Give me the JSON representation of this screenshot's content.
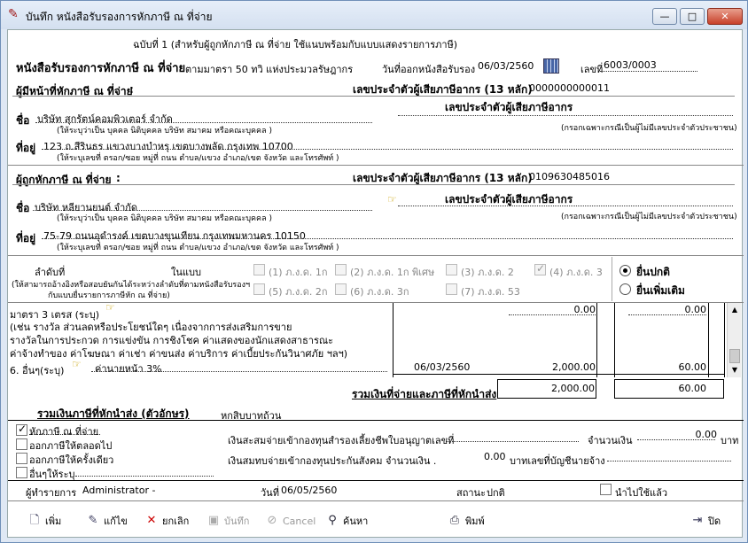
{
  "window": {
    "title": "บันทึก หนังสือรับรองการหักภาษี ณ ที่จ่าย",
    "min": "—",
    "max": "□",
    "close": "✕"
  },
  "header": {
    "copy_note": "ฉบับที่ 1 (สำหรับผู้ถูกหักภาษี ณ ที่จ่าย ใช้แนบพร้อมกับแบบแสดงรายการภาษี)",
    "form_title": "หนังสือรับรองการหักภาษี ณ ที่จ่าย",
    "law_ref": "ตามมาตรา 50 ทวิ แห่งประมวลรัษฎากร",
    "issue_date_label": "วันที่ออกหนังสือรับรอง",
    "issue_date": "06/03/2560",
    "number_label": "เลขที่",
    "number": "6003/0003"
  },
  "payer": {
    "section_label": "ผู้มีหน้าที่หักภาษี ณ ที่จ่าย",
    "colon": ":",
    "tax_id_label": "เลขประจำตัวผู้เสียภาษีอากร (13 หลัก)",
    "tax_id": "0000000000011",
    "tax_id2_label": "เลขประจำตัวผู้เสียภาษีอากร",
    "name_label": "ชื่อ",
    "name": "บริษัท สุกรัตน์คอมพิวเตอร์ จำกัด",
    "name_hint": "(ให้ระบุว่าเป็น บุคคล นิติบุคคล บริษัท สมาคม หรือคณะบุคคล )",
    "name_hint2": "(กรอกเฉพาะกรณีเป็นผู้ไม่มีเลขประจำตัวประชาชน)",
    "addr_label": "ที่อยู่",
    "address": "123 ถ.สีรินธร แขวงบางบำหรุ เขตบางพลัด กรุงเทพ 10700",
    "addr_hint": "(ให้ระบุเลขที่ ตรอก/ซอย หมู่ที่ ถนน ตำบล/แขวง อำเภอ/เขต จังหวัด และโทรศัพท์ )"
  },
  "payee": {
    "section_label": "ผู้ถูกหักภาษี ณ ที่จ่าย",
    "colon": ":",
    "tax_id_label": "เลขประจำตัวผู้เสียภาษีอากร (13 หลัก)",
    "tax_id": "0109630485016",
    "tax_id2_label": "เลขประจำตัวผู้เสียภาษีอากร",
    "name_label": "ชื่อ",
    "name": "บริษัท หลียานยนต์ จำกัด",
    "name_hint": "(ให้ระบุว่าเป็น บุคคล นิติบุคคล บริษัท สมาคม หรือคณะบุคคล )",
    "name_hint2": "(กรอกเฉพาะกรณีเป็นผู้ไม่มีเลขประจำตัวประชาชน)",
    "addr_label": "ที่อยู่",
    "address": "75-79 ถนนอุดำรงค์ เขตบางขุนเทียน กรุงเทพมหานคร 10150",
    "addr_hint": "(ให้ระบุเลขที่ ตรอก/ซอย หมู่ที่ ถนน ตำบล/แขวง อำเภอ/เขต จังหวัด และโทรศัพท์ )"
  },
  "attach": {
    "seq_label": "ลำดับที่",
    "seq_hint1": "(ให้สามารถอ้างอิงหรือสอบยันกันได้ระหว่างลำดับที่ตามหนังสือรับรองฯ",
    "seq_hint2": "กับแบบยื่นรายการภาษีหัก ณ ที่จ่าย)",
    "in_form_label": "ในแบบ",
    "forms": [
      {
        "label": "(1) ภ.ง.ด. 1ก",
        "checked": false
      },
      {
        "label": "(2) ภ.ง.ด. 1ก พิเศษ",
        "checked": false
      },
      {
        "label": "(3) ภ.ง.ด. 2",
        "checked": false
      },
      {
        "label": "(4) ภ.ง.ด. 3",
        "checked": true
      },
      {
        "label": "(5) ภ.ง.ด. 2ก",
        "checked": false
      },
      {
        "label": "(6) ภ.ง.ด. 3ก",
        "checked": false
      },
      {
        "label": "(7) ภ.ง.ด. 53",
        "checked": false
      }
    ],
    "filing": [
      {
        "label": "ยื่นปกติ",
        "selected": true
      },
      {
        "label": "ยื่นเพิ่มเติม",
        "selected": false
      }
    ]
  },
  "income": {
    "row5_lines": [
      "มาตรา 3 เตรส (ระบุ)",
      "(เช่น รางวัล ส่วนลดหรือประโยชน์ใดๆ เนื่องจากการส่งเสริมการขาย",
      "รางวัลในการประกวด การแข่งขัน การชิงโชค ค่าแสดงของนักแสดงสาธารณะ",
      "ค่าจ้างทำของ ค่าโฆษณา ค่าเช่า ค่าขนส่ง ค่าบริการ ค่าเบี้ยประกันวินาศภัย ฯลฯ)"
    ],
    "row5_amount": "0.00",
    "row5_tax": "0.00",
    "row6_label": "6. อื่นๆ(ระบุ)",
    "row6_desc": "ค่านายหน้า 3%",
    "row6_date": "06/03/2560",
    "row6_amount": "2,000.00",
    "row6_tax": "60.00",
    "total_label": "รวมเงินที่จ่ายและภาษีที่หักนำส่ง",
    "total_amount": "2,000.00",
    "total_tax": "60.00",
    "words_label": "รวมเงินภาษีที่หักนำส่ง (ตัวอักษร)",
    "words": "หกสิบบาทถ้วน"
  },
  "payer_type": {
    "options": [
      {
        "label": "หักภาษี ณ ที่จ่าย",
        "checked": true
      },
      {
        "label": "ออกภาษีให้ตลอดไป",
        "checked": false
      },
      {
        "label": "ออกภาษีให้ครั้งเดียว",
        "checked": false
      },
      {
        "label": "อื่นๆให้ระบุ",
        "checked": false
      }
    ],
    "fund_label": "เงินสะสมจ่ายเข้ากองทุนสำรองเลี้ยงชีพใบอนุญาตเลขที่",
    "fund_amount_label": "จำนวนเงิน",
    "fund_amount": "0.00",
    "baht": "บาท",
    "social_label": "เงินสมทบจ่ายเข้ากองทุนประกันสังคม จำนวนเงิน .",
    "social_amount": "0.00",
    "social_suffix": "บาทเลขที่บัญชีนายจ้าง"
  },
  "footer": {
    "recorder_label": "ผู้ทำรายการ",
    "recorder": "Administrator -",
    "date_label": "วันที่",
    "date": "06/05/2560",
    "status_label": "สถานะ",
    "status": "ปกติ",
    "applied_label": "นำไปใช้แล้ว"
  },
  "toolbar": {
    "add": "เพิ่ม",
    "edit": "แก้ไข",
    "cancel_doc": "ยกเลิก",
    "save": "บันทึก",
    "cancel": "Cancel",
    "search": "ค้นหา",
    "print": "พิมพ์",
    "close": "ปิด"
  }
}
